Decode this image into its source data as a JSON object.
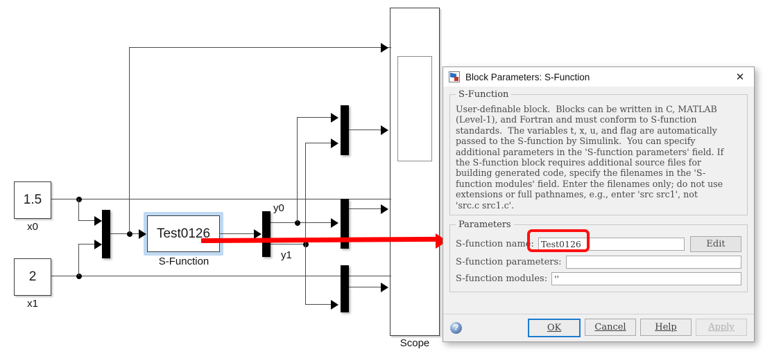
{
  "diagram": {
    "constants": [
      {
        "value": "1.5",
        "label": "x0"
      },
      {
        "value": "2",
        "label": "x1"
      }
    ],
    "sfunction": {
      "value": "Test0126",
      "label": "S-Function"
    },
    "demux_labels": {
      "y0": "y0",
      "y1": "y1"
    },
    "scope": {
      "label": "Scope"
    },
    "annotation_color": "#ff0000"
  },
  "dialog": {
    "title": "Block Parameters: S-Function",
    "close_label": "✕",
    "group_sfunction": {
      "legend": "S-Function",
      "description": "User-definable block.  Blocks can be written in C, MATLAB\n(Level-1), and Fortran and must conform to S-function\nstandards.  The variables t, x, u, and flag are automatically\npassed to the S-function by Simulink.  You can specify\nadditional parameters in the 'S-function parameters' field. If\nthe S-function block requires additional source files for\nbuilding generated code, specify the filenames in the 'S-\nfunction modules' field. Enter the filenames only; do not use\nextensions or full pathnames, e.g., enter 'src src1', not\n'src.c src1.c'."
    },
    "group_parameters": {
      "legend": "Parameters",
      "fields": [
        {
          "label": "S-function name:",
          "value": "Test0126",
          "placeholder": ""
        },
        {
          "label": "S-function parameters:",
          "value": "",
          "placeholder": ""
        },
        {
          "label": "S-function modules:",
          "value": "''",
          "placeholder": ""
        }
      ],
      "edit_button": "Edit"
    },
    "buttons": {
      "ok": "OK",
      "cancel": "Cancel",
      "help": "Help",
      "apply": "Apply",
      "help_icon": "?"
    },
    "accent": "#1c7ad1"
  }
}
